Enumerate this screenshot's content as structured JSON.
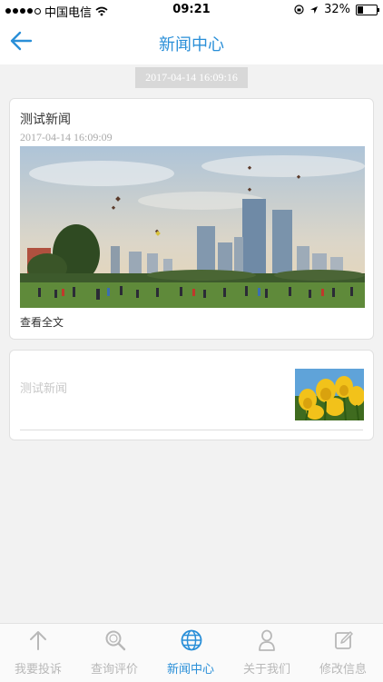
{
  "status_bar": {
    "carrier": "中国电信",
    "time": "09:21",
    "battery": "32%",
    "battery_level": 0.32
  },
  "nav": {
    "title": "新闻中心"
  },
  "timestamp_chip": "2017-04-14 16:09:16",
  "news": [
    {
      "title": "测试新闻",
      "date": "2017-04-14 16:09:09",
      "read_more": "查看全文"
    },
    {
      "title": "测试新闻"
    }
  ],
  "tabs": [
    {
      "label": "我要投诉",
      "icon": "arrow-up-icon"
    },
    {
      "label": "查询评价",
      "icon": "search-icon"
    },
    {
      "label": "新闻中心",
      "icon": "globe-icon",
      "active": true
    },
    {
      "label": "关于我们",
      "icon": "user-icon"
    },
    {
      "label": "修改信息",
      "icon": "edit-icon"
    }
  ],
  "colors": {
    "accent": "#2a8fd8",
    "inactive": "#b8b8b8"
  }
}
